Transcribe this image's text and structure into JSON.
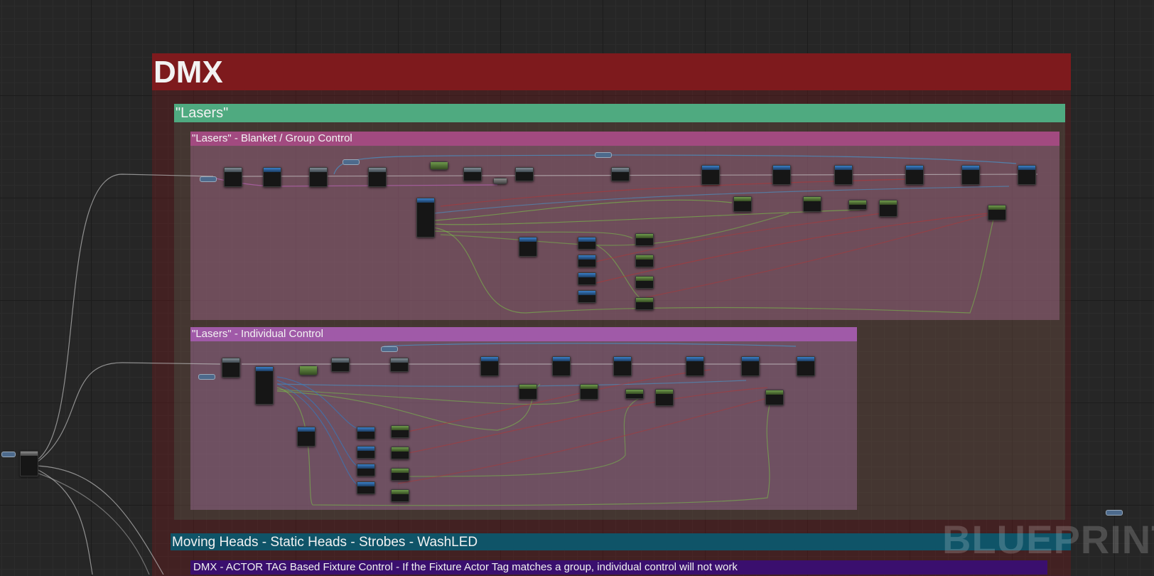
{
  "editor": {
    "watermark": "BLUEPRINT"
  },
  "comments": {
    "dmx": {
      "title": "DMX",
      "color": "#7e1a1d"
    },
    "lasers": {
      "title": "\"Lasers\"",
      "color": "#4faa80"
    },
    "blanket": {
      "title": "\"Lasers\" - Blanket / Group Control",
      "color": "#a24a80"
    },
    "individual": {
      "title": "\"Lasers\" - Individual Control",
      "color": "#a05aa8"
    },
    "moving_heads": {
      "title": "Moving Heads - Static Heads - Strobes - WashLED",
      "color": "#0f5468"
    },
    "actor_tag": {
      "title": "DMX - ACTOR TAG Based Fixture Control - If the Fixture Actor Tag matches a group, individual control will not work",
      "color": "#3a0f6e"
    }
  },
  "colors": {
    "exec_wire": "#d6d6d6",
    "float_wire": "#7bd047",
    "object_wire": "#3fa3e0",
    "vector_wire": "#d8c33a",
    "struct_wire": "#2f7fc9",
    "red_wire": "#b03636",
    "pink_wire": "#c567c4"
  }
}
